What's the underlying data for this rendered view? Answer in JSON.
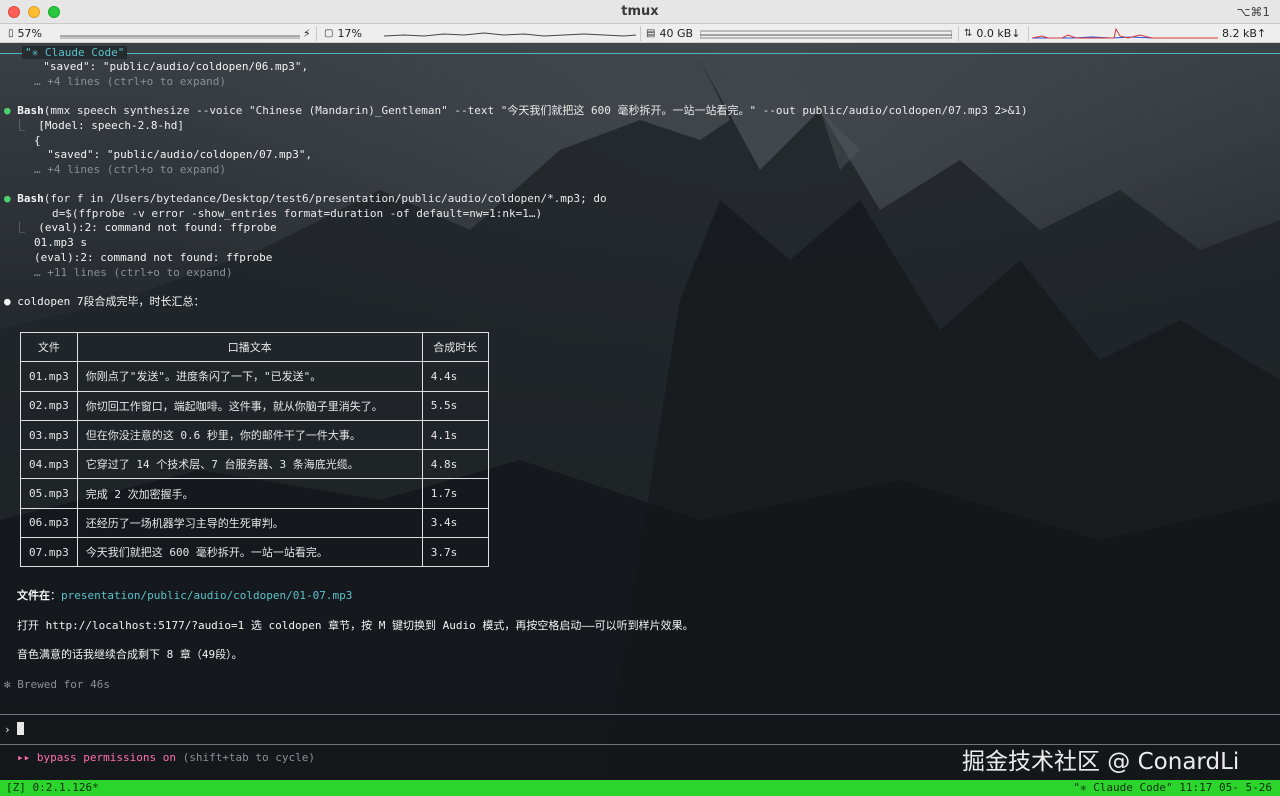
{
  "window": {
    "title": "tmux",
    "shortcut": "⌥⌘1"
  },
  "meters": {
    "battery": "57%",
    "cpu": "17%",
    "memory": "40 GB",
    "net_down": "0.0 kB↓",
    "net_up": "8.2 kB↑"
  },
  "pane": {
    "title": "\"✳ Claude Code\""
  },
  "log": {
    "l1": "  \"saved\": \"public/audio/coldopen/06.mp3\",",
    "l2": "… +4 lines (ctrl+o to expand)",
    "bash1_label": "Bash",
    "bash1_cmd": "(mmx speech synthesize --voice \"Chinese (Mandarin)_Gentleman\" --text \"今天我们就把这 600 毫秒拆开。一站一站看完。\" --out public/audio/coldopen/07.mp3 2>&1)",
    "b1_out1": "[Model: speech-2.8-hd]",
    "b1_out2": "{",
    "b1_out3": "  \"saved\": \"public/audio/coldopen/07.mp3\",",
    "b1_more": "… +4 lines (ctrl+o to expand)",
    "bash2_label": "Bash",
    "bash2_cmd": "(for f in /Users/bytedance/Desktop/test6/presentation/public/audio/coldopen/*.mp3; do",
    "bash2_cmd2": "d=$(ffprobe -v error -show_entries format=duration -of default=nw=1:nk=1…)",
    "b2_out1": "(eval):2: command not found: ffprobe",
    "b2_out2": "01.mp3 s",
    "b2_out3": "(eval):2: command not found: ffprobe",
    "b2_more": "… +11 lines (ctrl+o to expand)",
    "summary": "coldopen 7段合成完毕，时长汇总："
  },
  "table": {
    "headers": [
      "文件",
      "口播文本",
      "合成时长"
    ],
    "rows": [
      [
        "01.mp3",
        "你刚点了\"发送\"。进度条闪了一下，\"已发送\"。",
        "4.4s"
      ],
      [
        "02.mp3",
        "你切回工作窗口，端起咖啡。这件事，就从你脑子里消失了。",
        "5.5s"
      ],
      [
        "03.mp3",
        "但在你没注意的这 0.6 秒里，你的邮件干了一件大事。",
        "4.1s"
      ],
      [
        "04.mp3",
        "它穿过了 14 个技术层、7 台服务器、3 条海底光缆。",
        "4.8s"
      ],
      [
        "05.mp3",
        "完成 2 次加密握手。",
        "1.7s"
      ],
      [
        "06.mp3",
        "还经历了一场机器学习主导的生死审判。",
        "3.4s"
      ],
      [
        "07.mp3",
        "今天我们就把这 600 毫秒拆开。一站一站看完。",
        "3.7s"
      ]
    ]
  },
  "footer_text": {
    "file_label": "文件在",
    "file_path": "presentation/public/audio/coldopen/01-07.mp3",
    "open_line": "打开 http://localhost:5177/?audio=1 选 coldopen 章节，按 M 键切换到 Audio 模式，再按空格启动——可以听到样片效果。",
    "next_line": "音色满意的话我继续合成剩下 8 章（49段）。",
    "brewed": "✻ Brewed for 46s"
  },
  "prompt": {
    "symbol": "›"
  },
  "mode": {
    "arrows": "▸▸",
    "label": "bypass permissions on",
    "hint": "(shift+tab to cycle)"
  },
  "tmux": {
    "left": "[Z] 0:2.1.126*",
    "right": "\"✳ Claude Code\" 11:17 05- 5-26"
  },
  "watermark": "掘金技术社区 @ ConardLi",
  "colors": {
    "accent": "#59c2cc",
    "status_bar": "#2bd52b",
    "bullet": "#48d36a",
    "mode": "#ff6fa8"
  }
}
